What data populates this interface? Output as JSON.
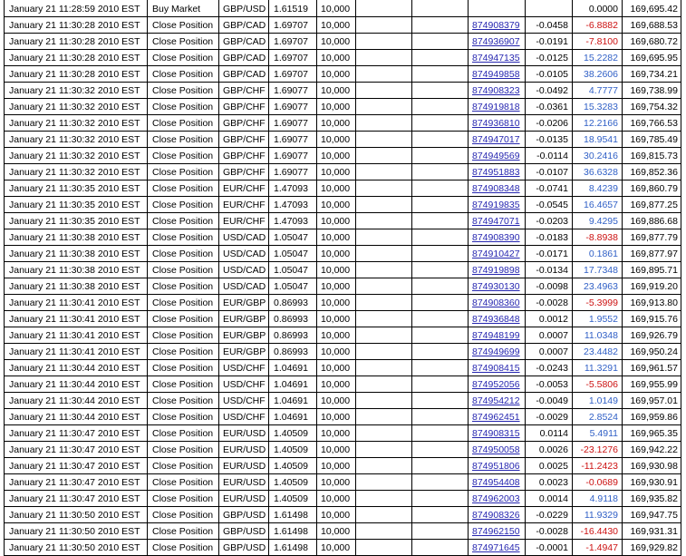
{
  "colors": {
    "grid": "#000000",
    "text": "#000000",
    "link": "#2626b0",
    "profit": "#2f5fc6",
    "loss": "#cc1111"
  },
  "rows": [
    {
      "time": "January 21 11:28:59 2010 EST",
      "action": "Buy Market",
      "symbol": "GBP/USD",
      "rate": "1.61519",
      "amount": "10,000",
      "pl": "0.0000",
      "balance": "169,695.42"
    },
    {
      "time": "January 21 11:30:28 2010 EST",
      "action": "Close Position",
      "symbol": "GBP/CAD",
      "rate": "1.69707",
      "amount": "10,000",
      "ticket": "874908379",
      "pips": "-0.0458",
      "pl": "-6.8882",
      "balance": "169,688.53"
    },
    {
      "time": "January 21 11:30:28 2010 EST",
      "action": "Close Position",
      "symbol": "GBP/CAD",
      "rate": "1.69707",
      "amount": "10,000",
      "ticket": "874936907",
      "pips": "-0.0191",
      "pl": "-7.8100",
      "balance": "169,680.72"
    },
    {
      "time": "January 21 11:30:28 2010 EST",
      "action": "Close Position",
      "symbol": "GBP/CAD",
      "rate": "1.69707",
      "amount": "10,000",
      "ticket": "874947135",
      "pips": "-0.0125",
      "pl": "15.2282",
      "balance": "169,695.95"
    },
    {
      "time": "January 21 11:30:28 2010 EST",
      "action": "Close Position",
      "symbol": "GBP/CAD",
      "rate": "1.69707",
      "amount": "10,000",
      "ticket": "874949858",
      "pips": "-0.0105",
      "pl": "38.2606",
      "balance": "169,734.21"
    },
    {
      "time": "January 21 11:30:32 2010 EST",
      "action": "Close Position",
      "symbol": "GBP/CHF",
      "rate": "1.69077",
      "amount": "10,000",
      "ticket": "874908323",
      "pips": "-0.0492",
      "pl": "4.7777",
      "balance": "169,738.99"
    },
    {
      "time": "January 21 11:30:32 2010 EST",
      "action": "Close Position",
      "symbol": "GBP/CHF",
      "rate": "1.69077",
      "amount": "10,000",
      "ticket": "874919818",
      "pips": "-0.0361",
      "pl": "15.3283",
      "balance": "169,754.32"
    },
    {
      "time": "January 21 11:30:32 2010 EST",
      "action": "Close Position",
      "symbol": "GBP/CHF",
      "rate": "1.69077",
      "amount": "10,000",
      "ticket": "874936810",
      "pips": "-0.0206",
      "pl": "12.2166",
      "balance": "169,766.53"
    },
    {
      "time": "January 21 11:30:32 2010 EST",
      "action": "Close Position",
      "symbol": "GBP/CHF",
      "rate": "1.69077",
      "amount": "10,000",
      "ticket": "874947017",
      "pips": "-0.0135",
      "pl": "18.9541",
      "balance": "169,785.49"
    },
    {
      "time": "January 21 11:30:32 2010 EST",
      "action": "Close Position",
      "symbol": "GBP/CHF",
      "rate": "1.69077",
      "amount": "10,000",
      "ticket": "874949569",
      "pips": "-0.0114",
      "pl": "30.2416",
      "balance": "169,815.73"
    },
    {
      "time": "January 21 11:30:32 2010 EST",
      "action": "Close Position",
      "symbol": "GBP/CHF",
      "rate": "1.69077",
      "amount": "10,000",
      "ticket": "874951883",
      "pips": "-0.0107",
      "pl": "36.6328",
      "balance": "169,852.36"
    },
    {
      "time": "January 21 11:30:35 2010 EST",
      "action": "Close Position",
      "symbol": "EUR/CHF",
      "rate": "1.47093",
      "amount": "10,000",
      "ticket": "874908348",
      "pips": "-0.0741",
      "pl": "8.4239",
      "balance": "169,860.79"
    },
    {
      "time": "January 21 11:30:35 2010 EST",
      "action": "Close Position",
      "symbol": "EUR/CHF",
      "rate": "1.47093",
      "amount": "10,000",
      "ticket": "874919835",
      "pips": "-0.0545",
      "pl": "16.4657",
      "balance": "169,877.25"
    },
    {
      "time": "January 21 11:30:35 2010 EST",
      "action": "Close Position",
      "symbol": "EUR/CHF",
      "rate": "1.47093",
      "amount": "10,000",
      "ticket": "874947071",
      "pips": "-0.0203",
      "pl": "9.4295",
      "balance": "169,886.68"
    },
    {
      "time": "January 21 11:30:38 2010 EST",
      "action": "Close Position",
      "symbol": "USD/CAD",
      "rate": "1.05047",
      "amount": "10,000",
      "ticket": "874908390",
      "pips": "-0.0183",
      "pl": "-8.8938",
      "balance": "169,877.79"
    },
    {
      "time": "January 21 11:30:38 2010 EST",
      "action": "Close Position",
      "symbol": "USD/CAD",
      "rate": "1.05047",
      "amount": "10,000",
      "ticket": "874910427",
      "pips": "-0.0171",
      "pl": "0.1861",
      "balance": "169,877.97"
    },
    {
      "time": "January 21 11:30:38 2010 EST",
      "action": "Close Position",
      "symbol": "USD/CAD",
      "rate": "1.05047",
      "amount": "10,000",
      "ticket": "874919898",
      "pips": "-0.0134",
      "pl": "17.7348",
      "balance": "169,895.71"
    },
    {
      "time": "January 21 11:30:38 2010 EST",
      "action": "Close Position",
      "symbol": "USD/CAD",
      "rate": "1.05047",
      "amount": "10,000",
      "ticket": "874930130",
      "pips": "-0.0098",
      "pl": "23.4963",
      "balance": "169,919.20"
    },
    {
      "time": "January 21 11:30:41 2010 EST",
      "action": "Close Position",
      "symbol": "EUR/GBP",
      "rate": "0.86993",
      "amount": "10,000",
      "ticket": "874908360",
      "pips": "-0.0028",
      "pl": "-5.3999",
      "balance": "169,913.80"
    },
    {
      "time": "January 21 11:30:41 2010 EST",
      "action": "Close Position",
      "symbol": "EUR/GBP",
      "rate": "0.86993",
      "amount": "10,000",
      "ticket": "874936848",
      "pips": "0.0012",
      "pl": "1.9552",
      "balance": "169,915.76"
    },
    {
      "time": "January 21 11:30:41 2010 EST",
      "action": "Close Position",
      "symbol": "EUR/GBP",
      "rate": "0.86993",
      "amount": "10,000",
      "ticket": "874948199",
      "pips": "0.0007",
      "pl": "11.0348",
      "balance": "169,926.79"
    },
    {
      "time": "January 21 11:30:41 2010 EST",
      "action": "Close Position",
      "symbol": "EUR/GBP",
      "rate": "0.86993",
      "amount": "10,000",
      "ticket": "874949699",
      "pips": "0.0007",
      "pl": "23.4482",
      "balance": "169,950.24"
    },
    {
      "time": "January 21 11:30:44 2010 EST",
      "action": "Close Position",
      "symbol": "USD/CHF",
      "rate": "1.04691",
      "amount": "10,000",
      "ticket": "874908415",
      "pips": "-0.0243",
      "pl": "11.3291",
      "balance": "169,961.57"
    },
    {
      "time": "January 21 11:30:44 2010 EST",
      "action": "Close Position",
      "symbol": "USD/CHF",
      "rate": "1.04691",
      "amount": "10,000",
      "ticket": "874952056",
      "pips": "-0.0053",
      "pl": "-5.5806",
      "balance": "169,955.99"
    },
    {
      "time": "January 21 11:30:44 2010 EST",
      "action": "Close Position",
      "symbol": "USD/CHF",
      "rate": "1.04691",
      "amount": "10,000",
      "ticket": "874954212",
      "pips": "-0.0049",
      "pl": "1.0149",
      "balance": "169,957.01"
    },
    {
      "time": "January 21 11:30:44 2010 EST",
      "action": "Close Position",
      "symbol": "USD/CHF",
      "rate": "1.04691",
      "amount": "10,000",
      "ticket": "874962451",
      "pips": "-0.0029",
      "pl": "2.8524",
      "balance": "169,959.86"
    },
    {
      "time": "January 21 11:30:47 2010 EST",
      "action": "Close Position",
      "symbol": "EUR/USD",
      "rate": "1.40509",
      "amount": "10,000",
      "ticket": "874908315",
      "pips": "0.0114",
      "pl": "5.4911",
      "balance": "169,965.35"
    },
    {
      "time": "January 21 11:30:47 2010 EST",
      "action": "Close Position",
      "symbol": "EUR/USD",
      "rate": "1.40509",
      "amount": "10,000",
      "ticket": "874950058",
      "pips": "0.0026",
      "pl": "-23.1276",
      "balance": "169,942.22"
    },
    {
      "time": "January 21 11:30:47 2010 EST",
      "action": "Close Position",
      "symbol": "EUR/USD",
      "rate": "1.40509",
      "amount": "10,000",
      "ticket": "874951806",
      "pips": "0.0025",
      "pl": "-11.2423",
      "balance": "169,930.98"
    },
    {
      "time": "January 21 11:30:47 2010 EST",
      "action": "Close Position",
      "symbol": "EUR/USD",
      "rate": "1.40509",
      "amount": "10,000",
      "ticket": "874954408",
      "pips": "0.0023",
      "pl": "-0.0689",
      "balance": "169,930.91"
    },
    {
      "time": "January 21 11:30:47 2010 EST",
      "action": "Close Position",
      "symbol": "EUR/USD",
      "rate": "1.40509",
      "amount": "10,000",
      "ticket": "874962003",
      "pips": "0.0014",
      "pl": "4.9118",
      "balance": "169,935.82"
    },
    {
      "time": "January 21 11:30:50 2010 EST",
      "action": "Close Position",
      "symbol": "GBP/USD",
      "rate": "1.61498",
      "amount": "10,000",
      "ticket": "874908326",
      "pips": "-0.0229",
      "pl": "11.9329",
      "balance": "169,947.75"
    },
    {
      "time": "January 21 11:30:50 2010 EST",
      "action": "Close Position",
      "symbol": "GBP/USD",
      "rate": "1.61498",
      "amount": "10,000",
      "ticket": "874962150",
      "pips": "-0.0028",
      "pl": "-16.4430",
      "balance": "169,931.31"
    },
    {
      "time": "January 21 11:30:50 2010 EST",
      "action": "Close Position",
      "symbol": "GBP/USD",
      "rate": "1.61498",
      "amount": "10,000",
      "ticket": "874971645",
      "pips": "-0.0001",
      "pl": "-1.4947",
      "balance": "169,929.82"
    }
  ]
}
